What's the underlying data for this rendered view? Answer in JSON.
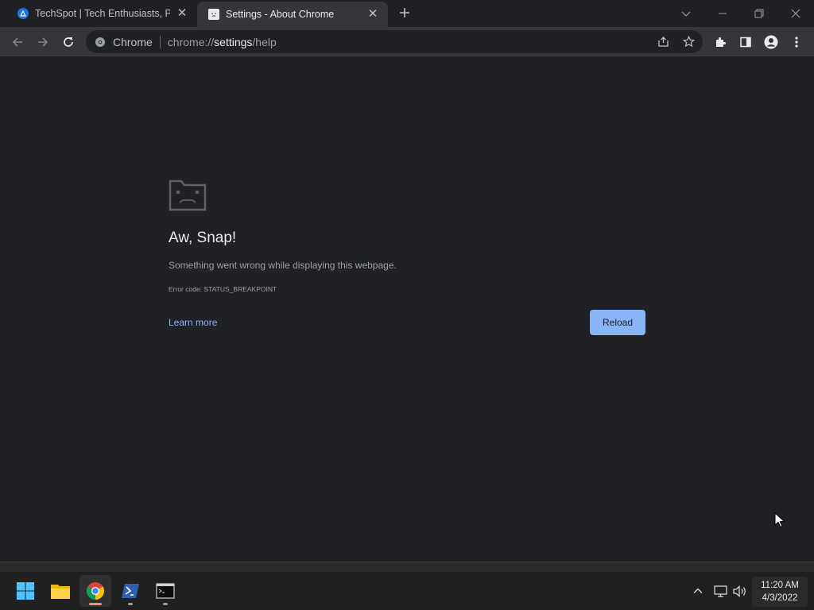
{
  "browser": {
    "tabs": [
      {
        "title": "TechSpot | Tech Enthusiasts, Pow",
        "active": false,
        "favicon": "techspot-icon"
      },
      {
        "title": "Settings - About Chrome",
        "active": true,
        "favicon": "sad-tab-icon"
      }
    ],
    "new_tab_icon": "plus-icon",
    "omnibox": {
      "chip": "Chrome",
      "url_scheme": "chrome://",
      "url_host": "settings",
      "url_path": "/help"
    }
  },
  "error_page": {
    "title": "Aw, Snap!",
    "message": "Something went wrong while displaying this webpage.",
    "error_code": "Error code: STATUS_BREAKPOINT",
    "learn_more": "Learn more",
    "reload_label": "Reload"
  },
  "taskbar": {
    "apps": [
      "windows-start",
      "file-explorer",
      "google-chrome",
      "powershell",
      "command-prompt"
    ],
    "clock_time": "11:20 AM",
    "clock_date": "4/3/2022"
  },
  "colors": {
    "page_bg": "#202124",
    "toolbar_bg": "#35363a",
    "link": "#8ab4f8",
    "button_bg": "#8ab4f8"
  }
}
